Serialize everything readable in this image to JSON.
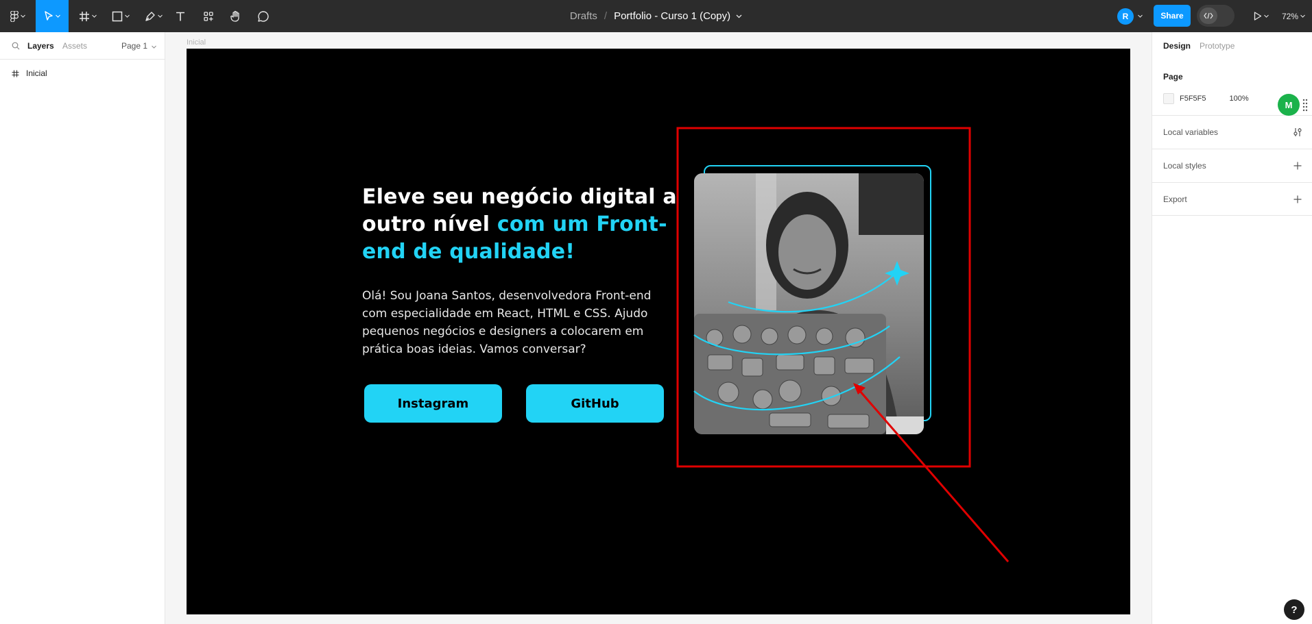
{
  "toolbar": {
    "breadcrumb": "Drafts",
    "separator": "/",
    "file_name": "Portfolio - Curso 1 (Copy)",
    "avatar_initial": "R",
    "share_label": "Share",
    "zoom": "72%",
    "tools": [
      "main-menu",
      "move",
      "frame",
      "shape",
      "pen",
      "text",
      "resources",
      "hand",
      "comment"
    ]
  },
  "left_panel": {
    "tab_layers": "Layers",
    "tab_assets": "Assets",
    "page_selector": "Page 1",
    "layers": [
      {
        "name": "Inicial",
        "type": "frame"
      }
    ]
  },
  "canvas": {
    "frame_label": "Inicial",
    "headline_white": "Eleve seu negócio digital a outro nível ",
    "headline_accent": "com um Front-end de qualidade!",
    "intro": "Olá! Sou Joana Santos, desenvolvedora Front-end com especialidade em React, HTML e CSS. Ajudo pequenos negócios e designers a colocarem em prática boas ideias. Vamos conversar?",
    "button_instagram": "Instagram",
    "button_github": "GitHub",
    "photo_alt": "Woman smiling at a laptop covered in stickers",
    "colors": {
      "background": "#000000",
      "accent": "#22d3f5",
      "annotation": "#e00000"
    }
  },
  "right_panel": {
    "tab_design": "Design",
    "tab_prototype": "Prototype",
    "page_section": "Page",
    "page_color": "F5F5F5",
    "page_opacity": "100%",
    "plugin_badge": "M",
    "local_variables": "Local variables",
    "local_styles": "Local styles",
    "export": "Export",
    "help": "?"
  }
}
